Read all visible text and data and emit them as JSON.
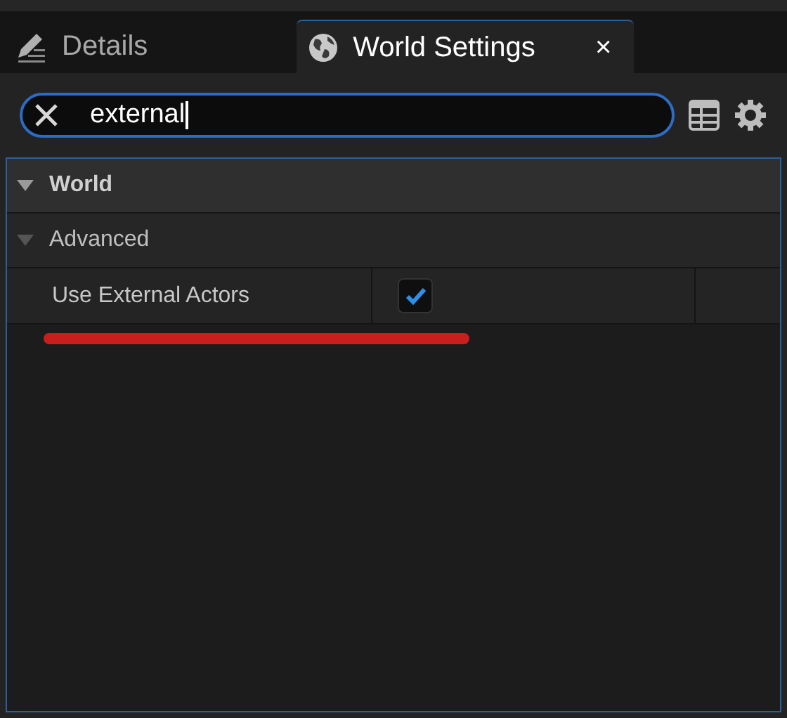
{
  "tabs": [
    {
      "label": "Details",
      "kind": "pencil",
      "selected": false
    },
    {
      "label": "World Settings",
      "kind": "globe",
      "selected": true,
      "close_label": "×"
    }
  ],
  "search": {
    "value": "external"
  },
  "categories": [
    {
      "label": "World",
      "expanded": true,
      "kind": "top"
    },
    {
      "label": "Advanced",
      "expanded": true,
      "kind": "sub"
    }
  ],
  "properties": [
    {
      "label": "Use External Actors",
      "kind": "checkbox",
      "checked": true
    }
  ],
  "annotation": {
    "kind": "underline",
    "color": "#c81e1e"
  }
}
